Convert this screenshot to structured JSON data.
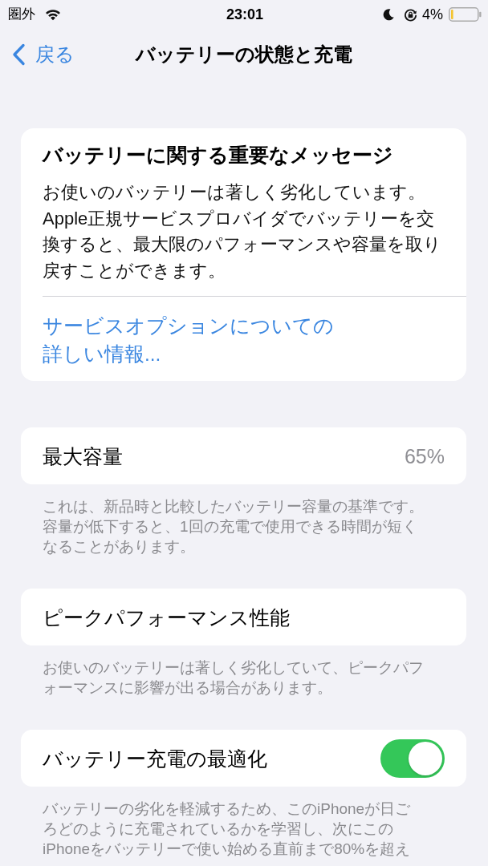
{
  "status_bar": {
    "carrier": "圏外",
    "time": "23:01",
    "battery_percent": "4%"
  },
  "nav_bar": {
    "back_label": "戻る",
    "title": "バッテリーの状態と充電"
  },
  "message_card": {
    "title": "バッテリーに関する重要なメッセージ",
    "body": "お使いのバッテリーは著しく劣化しています。Apple正規サービスプロバイダでバッテリーを交換すると、最大限のパフォーマンスや容量を取り戻すことができます。",
    "link": "サービスオプションについての詳しい情報..."
  },
  "sections": [
    {
      "kind": "value",
      "label": "最大容量",
      "value": "65%",
      "footer": "これは、新品時と比較したバッテリー容量の基準です。容量が低下すると、1回の充電で使用できる時間が短くなることがあります。"
    },
    {
      "kind": "plain",
      "label": "ピークパフォーマンス性能",
      "footer": "お使いのバッテリーは著しく劣化していて、ピークパフォーマンスに影響が出る場合があります。"
    },
    {
      "kind": "toggle",
      "label": "バッテリー充電の最適化",
      "on": true,
      "footer": "バッテリーの劣化を軽減するため、このiPhoneが日ごろどのように充電されているかを学習し、次にこのiPhoneをバッテリーで使い始める直前まで80%を超え"
    }
  ]
}
